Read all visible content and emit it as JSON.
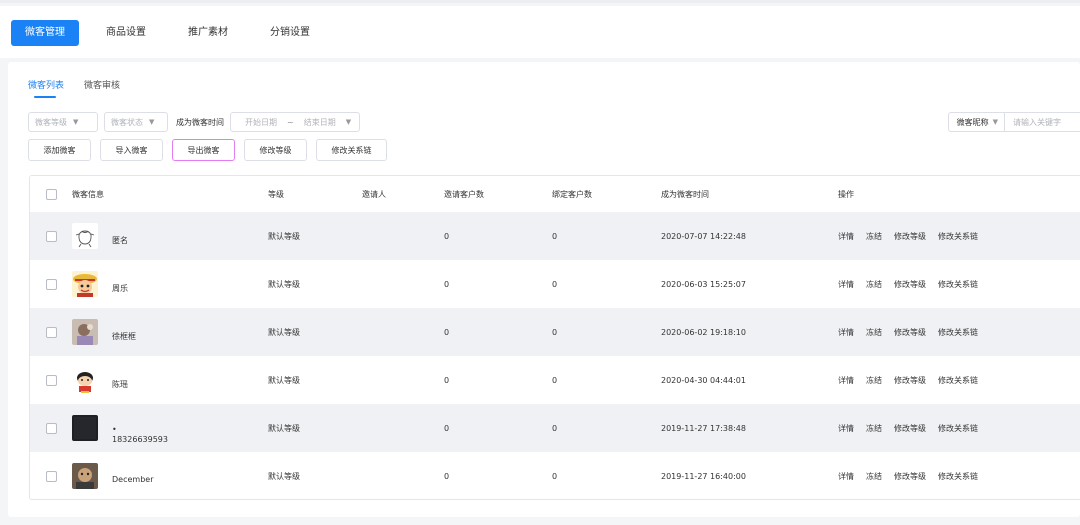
{
  "top_tabs": [
    {
      "label": "微客管理",
      "active": true
    },
    {
      "label": "商品设置",
      "active": false
    },
    {
      "label": "推广素材",
      "active": false
    },
    {
      "label": "分销设置",
      "active": false
    }
  ],
  "sub_tabs": [
    {
      "label": "微客列表",
      "active": true
    },
    {
      "label": "微客审核",
      "active": false
    }
  ],
  "filters": {
    "level_placeholder": "微客等级",
    "status_placeholder": "微客状态",
    "join_time_label": "成为微客时间",
    "start_date_placeholder": "开始日期",
    "separator": "~",
    "end_date_placeholder": "结束日期"
  },
  "search": {
    "field": "微客昵称",
    "placeholder": "请输入关键字"
  },
  "actions": {
    "add": "添加微客",
    "import": "导入微客",
    "export": "导出微客",
    "edit_level": "修改等级",
    "edit_relation": "修改关系链"
  },
  "table": {
    "headers": {
      "info": "微客信息",
      "level": "等级",
      "inviter": "邀请人",
      "invited_count": "邀请客户数",
      "bound_count": "绑定客户数",
      "join_time": "成为微客时间",
      "ops": "操作"
    },
    "op_labels": {
      "detail": "详情",
      "freeze": "冻结",
      "edit_level": "修改等级",
      "edit_relation": "修改关系链"
    },
    "rows": [
      {
        "name": "匿名",
        "name2": "",
        "avatar": "outline-face-icon",
        "level": "默认等级",
        "inviter": "",
        "invited": "0",
        "bound": "0",
        "time": "2020-07-07 14:22:48"
      },
      {
        "name": "周乐",
        "name2": "",
        "avatar": "cartoon-pirate-avatar-icon",
        "level": "默认等级",
        "inviter": "",
        "invited": "0",
        "bound": "0",
        "time": "2020-06-03 15:25:07"
      },
      {
        "name": "徐框框",
        "name2": "",
        "avatar": "photo-avatar-icon",
        "level": "默认等级",
        "inviter": "",
        "invited": "0",
        "bound": "0",
        "time": "2020-06-02 19:18:10"
      },
      {
        "name": "陈瑶",
        "name2": "",
        "avatar": "cartoon-kid-avatar-icon",
        "level": "默认等级",
        "inviter": "",
        "invited": "0",
        "bound": "0",
        "time": "2020-04-30 04:44:01"
      },
      {
        "name": "•",
        "name2": "18326639593",
        "avatar": "dark-square-avatar-icon",
        "level": "默认等级",
        "inviter": "",
        "invited": "0",
        "bound": "0",
        "time": "2019-11-27 17:38:48"
      },
      {
        "name": "December",
        "name2": "",
        "avatar": "photo-avatar-icon",
        "level": "默认等级",
        "inviter": "",
        "invited": "0",
        "bound": "0",
        "time": "2019-11-27 16:40:00"
      }
    ]
  },
  "colors": {
    "accent": "#1a82f5",
    "highlight_border": "#e27ef2",
    "row_shade": "#f0f1f4"
  }
}
